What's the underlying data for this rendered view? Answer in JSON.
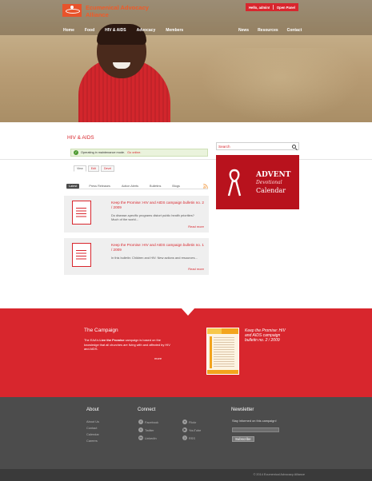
{
  "brand": {
    "name_line1": "Ecumenical Advocacy",
    "name_line2": "Alliance"
  },
  "userbar": {
    "greeting": "Hello, admin!",
    "panel": "Open Panel"
  },
  "nav_left": [
    "Home",
    "Food",
    "HIV & AIDS",
    "Advocacy",
    "Members"
  ],
  "nav_right": [
    "News",
    "Resources",
    "Contact"
  ],
  "page": {
    "title": "HIV & AIDS"
  },
  "status": {
    "message": "Operating in maintenance mode.",
    "link": "Go online."
  },
  "view_tabs": [
    "View",
    "Edit",
    "Devel"
  ],
  "content_tabs": [
    "Latest",
    "Press Releases",
    "Action Alerts",
    "Bulletins",
    "Blogs"
  ],
  "posts": [
    {
      "title": "Keep the Promise: HIV and AIDS campaign bulletin no. 2 / 2009",
      "excerpt": "Do disease-specific programs distort public health priorities? Much of the world...",
      "more": "Read more"
    },
    {
      "title": "Keep the Promise: HIV and AIDS campaign bulletin no. 1 / 2009",
      "excerpt": "In this bulletin: Children and HIV: New actions and resources...",
      "more": "Read more"
    }
  ],
  "search": {
    "placeholder": "Search"
  },
  "advent": {
    "line1": "ADVENT",
    "line2": "Devotional",
    "line3": "Calendar"
  },
  "campaign": {
    "heading": "The Campaign",
    "text_pre": "The EAA's ",
    "text_bold": "Live the Promise",
    "text_post": " campaign is based on the knowledge that all churches are living with and affected by HIV and AIDS.",
    "more": "more",
    "cover_title": "Keep the Promise: HIV and AIDS campaign bulletin no. 2 / 2009"
  },
  "footer": {
    "about": {
      "heading": "About",
      "links": [
        "About Us",
        "Contact",
        "Calendar",
        "Careers"
      ]
    },
    "connect": {
      "heading": "Connect",
      "links": [
        "Facebook",
        "Twitter",
        "LinkedIn",
        "Flickr",
        "YouTube",
        "RSS"
      ]
    },
    "newsletter": {
      "heading": "Newsletter",
      "text": "Stay informed on this campaign!",
      "button": "Subscribe"
    }
  },
  "copyright": "© 2014 Ecumenical Advocacy Alliance",
  "colors": {
    "accent": "#d8262d",
    "logo": "#f05a28",
    "footer": "#4c4c4c"
  }
}
